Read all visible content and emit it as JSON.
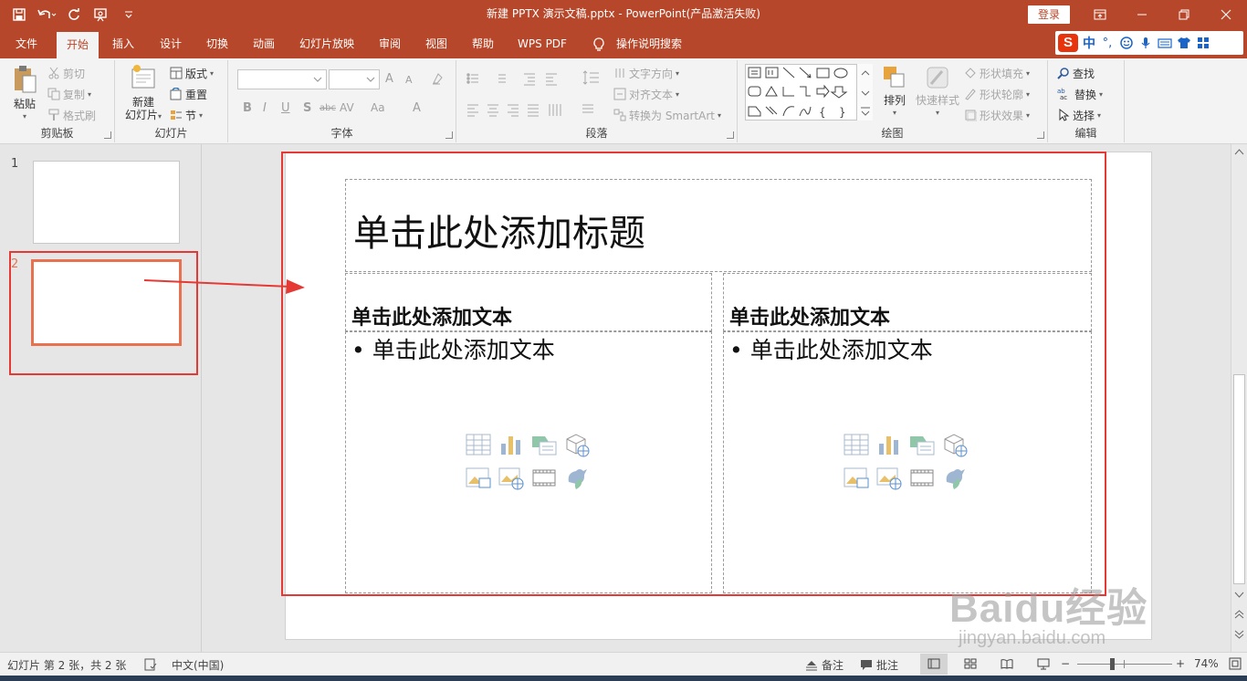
{
  "window": {
    "title": "新建 PPTX 演示文稿.pptx  -  PowerPoint(产品激活失败)",
    "login_label": "登录"
  },
  "tabs": [
    {
      "label": "文件",
      "active": false
    },
    {
      "label": "开始",
      "active": true
    },
    {
      "label": "插入",
      "active": false
    },
    {
      "label": "设计",
      "active": false
    },
    {
      "label": "切换",
      "active": false
    },
    {
      "label": "动画",
      "active": false
    },
    {
      "label": "幻灯片放映",
      "active": false
    },
    {
      "label": "审阅",
      "active": false
    },
    {
      "label": "视图",
      "active": false
    },
    {
      "label": "帮助",
      "active": false
    },
    {
      "label": "WPS PDF",
      "active": false
    }
  ],
  "tell_me": "操作说明搜索",
  "ime": {
    "mode": "中",
    "punct": "°,"
  },
  "ribbon": {
    "clipboard": {
      "label": "剪贴板",
      "paste": "粘贴",
      "cut": "剪切",
      "copy": "复制",
      "format_painter": "格式刷"
    },
    "slides": {
      "label": "幻灯片",
      "new_slide_line1": "新建",
      "new_slide_line2": "幻灯片",
      "layout": "版式",
      "reset": "重置",
      "section": "节"
    },
    "font": {
      "label": "字体",
      "bold": "B",
      "italic": "I",
      "underline": "U",
      "shadow": "S",
      "strike": "abc",
      "spacing": "AV",
      "case": "Aa",
      "color": "A",
      "grow": "A",
      "shrink": "A"
    },
    "paragraph": {
      "label": "段落",
      "text_direction": "文字方向",
      "align_text": "对齐文本",
      "smartart": "转换为 SmartArt"
    },
    "drawing": {
      "label": "绘图",
      "arrange": "排列",
      "quick_styles": "快速样式",
      "shape_fill": "形状填充",
      "shape_outline": "形状轮廓",
      "shape_effects": "形状效果"
    },
    "editing": {
      "label": "编辑",
      "find": "查找",
      "replace": "替换",
      "select": "选择"
    }
  },
  "thumbnails": [
    {
      "number": "1",
      "selected": false
    },
    {
      "number": "2",
      "selected": true
    }
  ],
  "slide": {
    "title_placeholder": "单击此处添加标题",
    "left_heading": "单击此处添加文本",
    "left_body": "• 单击此处添加文本",
    "right_heading": "单击此处添加文本",
    "right_body": "• 单击此处添加文本"
  },
  "status": {
    "slide_info": "幻灯片 第 2 张，共 2 张",
    "language": "中文(中国)",
    "notes": "备注",
    "comments": "批注",
    "zoom": "74%",
    "zoom_minus": "−",
    "zoom_plus": "+"
  },
  "watermark": {
    "main": "Baidu经验",
    "sub": "jingyan.baidu.com"
  },
  "colors": {
    "accent": "#b7472a",
    "selection": "#e8724f",
    "annotation_red": "#e53935"
  }
}
